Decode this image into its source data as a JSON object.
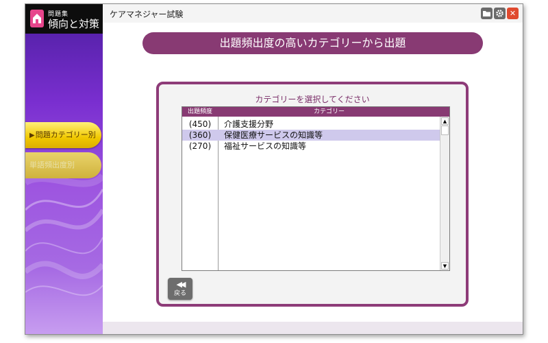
{
  "logo": {
    "small": "問題集",
    "title": "傾向と対策"
  },
  "window": {
    "title": "ケアマネジャー試験"
  },
  "titlebar_buttons": [
    {
      "icon": "folder-icon",
      "glyph": "▬"
    },
    {
      "icon": "gear-icon",
      "glyph": "✱"
    },
    {
      "icon": "close-icon",
      "glyph": "✕"
    }
  ],
  "sidebar": {
    "items": [
      {
        "label": "問題カテゴリー別",
        "marker": "▶",
        "active": true
      },
      {
        "label": "単語頻出度別",
        "active": false
      }
    ]
  },
  "banner": "出題頻出度の高いカテゴリーから出題",
  "panel": {
    "heading": "カテゴリーを選択してください",
    "columns": {
      "frequency": "出題頻度",
      "category": "カテゴリー"
    },
    "rows": [
      {
        "frequency": "(450)",
        "category": "介護支援分野",
        "selected": false
      },
      {
        "frequency": "(360)",
        "category": "保健医療サービスの知識等",
        "selected": true
      },
      {
        "frequency": "(270)",
        "category": "福祉サービスの知識等",
        "selected": false
      }
    ],
    "scroll": {
      "up": "▲",
      "down": "▼"
    }
  },
  "back_button": {
    "icon": "◀◀",
    "label": "戻る"
  },
  "colors": {
    "accent": "#883a73",
    "sidebar_active": "#f0c800",
    "selection": "#cfc9ec",
    "close": "#e04a2f"
  }
}
